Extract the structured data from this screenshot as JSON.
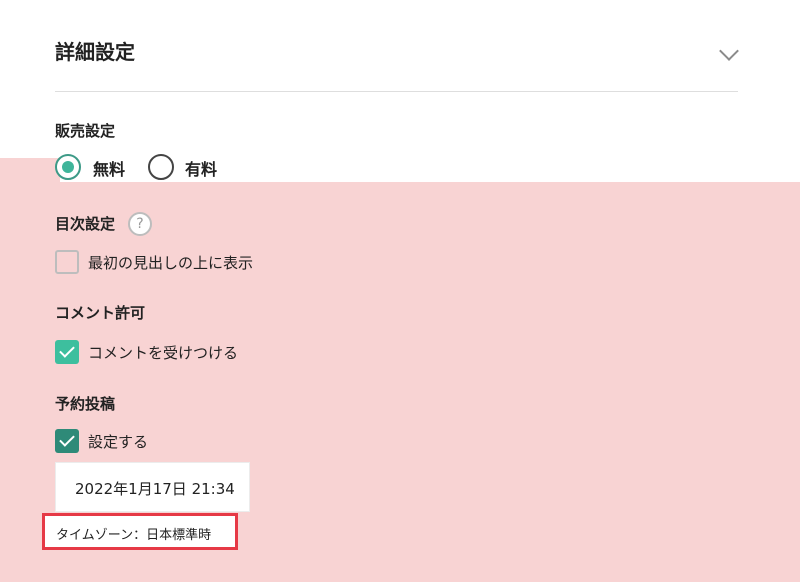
{
  "header": {
    "title": "詳細設定"
  },
  "sales": {
    "label": "販売設定",
    "options": [
      {
        "label": "無料",
        "selected": true
      },
      {
        "label": "有料",
        "selected": false
      }
    ]
  },
  "toc": {
    "label": "目次設定",
    "help_glyph": "?",
    "checkbox_label": "最初の見出しの上に表示",
    "checked": false
  },
  "comments": {
    "label": "コメント許可",
    "checkbox_label": "コメントを受けつける",
    "checked": true
  },
  "schedule": {
    "label": "予約投稿",
    "checkbox_label": "設定する",
    "checked": true,
    "datetime": "2022年1月17日 21:34",
    "timezone": "タイムゾーン：日本標準時"
  },
  "colors": {
    "highlight_background": "#f8d3d3",
    "accent_green": "#3dbf9e",
    "accent_green_dark": "#2e8a78",
    "highlight_border": "#e63946"
  }
}
